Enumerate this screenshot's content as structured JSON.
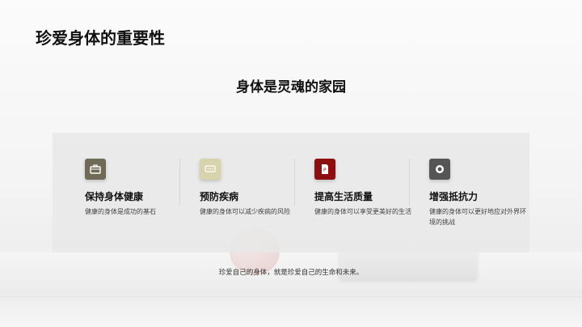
{
  "slide": {
    "title": "珍爱身体的重要性",
    "subtitle": "身体是灵魂的家园",
    "footer": "珍爱自己的身体，就是珍爱自己的生命和未来。"
  },
  "cards": [
    {
      "icon": "briefcase-icon",
      "color": "#6e6a55",
      "title": "保持身体健康",
      "desc": "健康的身体是成功的基石"
    },
    {
      "icon": "chat-icon",
      "color": "#d7d3ac",
      "title": "预防疾病",
      "desc": "健康的身体可以减少疾病的风险"
    },
    {
      "icon": "document-icon",
      "color": "#8d0e0e",
      "title": "提高生活质量",
      "desc": "健康的身体可以享受更美好的生活"
    },
    {
      "icon": "target-icon",
      "color": "#555555",
      "title": "增强抵抗力",
      "desc": "健康的身体可以更好地应对外界环境的挑战"
    }
  ]
}
